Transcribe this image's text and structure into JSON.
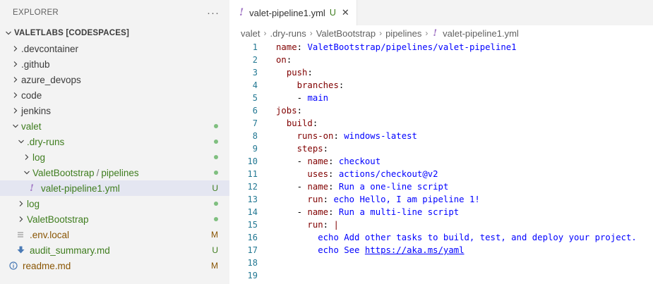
{
  "explorer": {
    "title": "EXPLORER",
    "more": "···",
    "root": "VALETLABS [CODESPACES]",
    "items": [
      {
        "label": ".devcontainer",
        "status": ""
      },
      {
        "label": ".github",
        "status": ""
      },
      {
        "label": "azure_devops",
        "status": ""
      },
      {
        "label": "code",
        "status": ""
      },
      {
        "label": "jenkins",
        "status": ""
      },
      {
        "label": "valet",
        "status": "dot"
      },
      {
        "label": ".dry-runs",
        "status": "dot"
      },
      {
        "label": "log",
        "status": "dot"
      },
      {
        "label": "ValetBootstrap",
        "sep": "/",
        "label2": "pipelines",
        "status": "dot"
      },
      {
        "label": "valet-pipeline1.yml",
        "status": "U"
      },
      {
        "label": "log",
        "status": "dot"
      },
      {
        "label": "ValetBootstrap",
        "status": "dot"
      },
      {
        "label": ".env.local",
        "status": "M"
      },
      {
        "label": "audit_summary.md",
        "status": "U"
      },
      {
        "label": "readme.md",
        "status": "M"
      }
    ]
  },
  "tab": {
    "icon": "!",
    "name": "valet-pipeline1.yml",
    "status": "U",
    "close": "✕"
  },
  "breadcrumb": [
    "valet",
    ".dry-runs",
    "ValetBootstrap",
    "pipelines",
    "valet-pipeline1.yml"
  ],
  "breadcrumb_icon": "!",
  "code": {
    "line_numbers": [
      "1",
      "2",
      "3",
      "4",
      "5",
      "6",
      "7",
      "8",
      "9",
      "10",
      "11",
      "12",
      "13",
      "14",
      "15",
      "16",
      "17",
      "18",
      "19"
    ],
    "l1": {
      "k": "name",
      "v": "ValetBootstrap/pipelines/valet-pipeline1"
    },
    "l2": {
      "k": "on"
    },
    "l3": {
      "k": "push"
    },
    "l4": {
      "k": "branches"
    },
    "l5": {
      "dash": "- ",
      "v": "main"
    },
    "l6": {
      "k": "jobs"
    },
    "l7": {
      "k": "build"
    },
    "l8": {
      "k": "runs-on",
      "v": "windows-latest"
    },
    "l9": {
      "k": "steps"
    },
    "l10": {
      "dash": "- ",
      "k": "name",
      "v": "checkout"
    },
    "l11": {
      "k": "uses",
      "v": "actions/checkout@v2"
    },
    "l12": {
      "dash": "- ",
      "k": "name",
      "v": "Run a one-line script"
    },
    "l13": {
      "k": "run",
      "v": "echo Hello, I am pipeline 1!"
    },
    "l14": {
      "dash": "- ",
      "k": "name",
      "v": "Run a multi-line script"
    },
    "l15": {
      "k": "run",
      "v": "|"
    },
    "l16": {
      "v": "echo Add other tasks to build, test, and deploy your project."
    },
    "l17": {
      "v": "echo See ",
      "link": "https://aka.ms/yaml"
    },
    "colon": ":"
  }
}
